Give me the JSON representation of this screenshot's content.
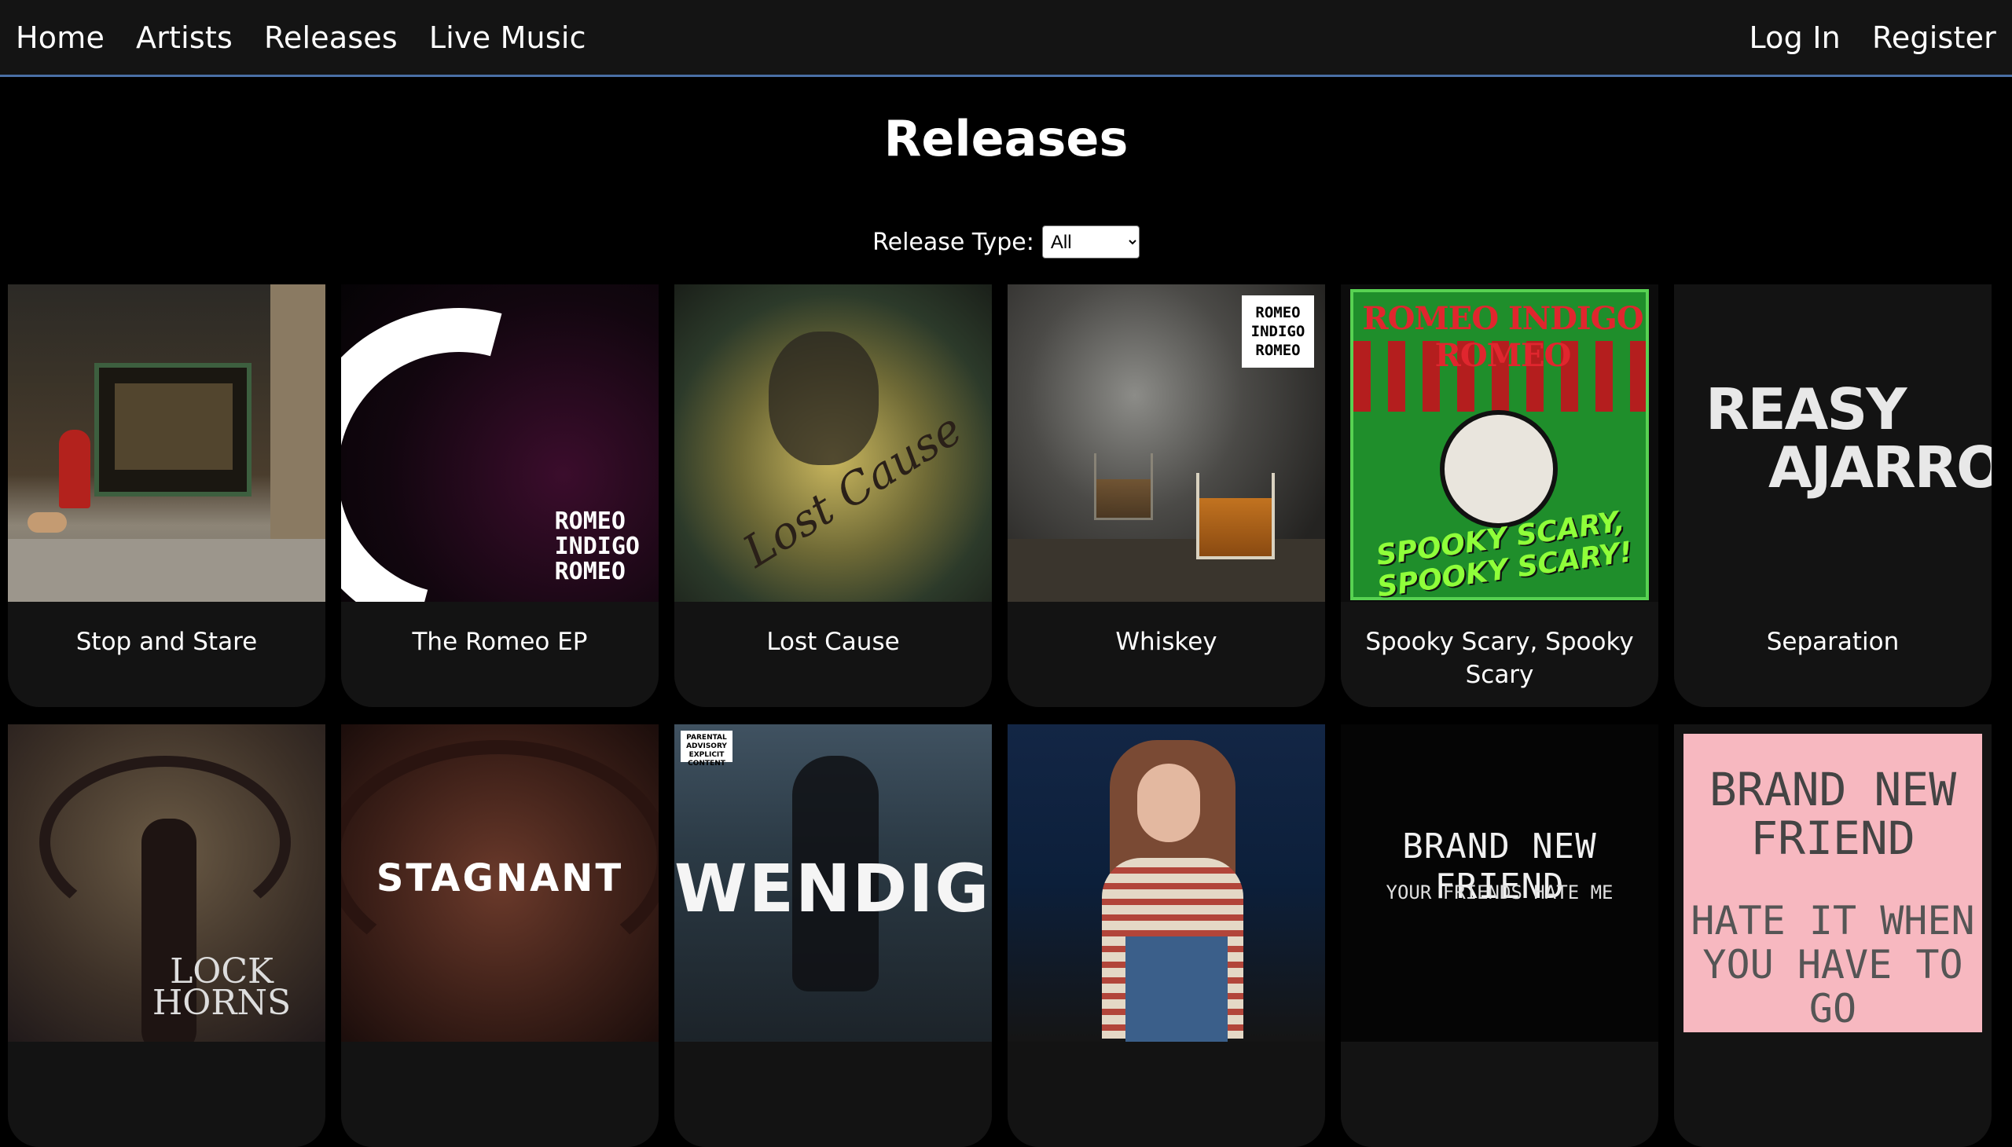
{
  "nav": {
    "left": [
      "Home",
      "Artists",
      "Releases",
      "Live Music"
    ],
    "right": [
      "Log In",
      "Register"
    ]
  },
  "page": {
    "title": "Releases",
    "filter_label": "Release Type:",
    "filter_value": "All"
  },
  "releases": [
    {
      "title": "Stop and Stare"
    },
    {
      "title": "The Romeo EP",
      "cover_text": "ROMEO\nINDIGO\nROMEO"
    },
    {
      "title": "Lost Cause",
      "cover_text": "Lost Cause"
    },
    {
      "title": "Whiskey",
      "cover_text": "ROMEO\nINDIGO\nROMEO"
    },
    {
      "title": "Spooky Scary, Spooky Scary",
      "cover_header": "ROMEO INDIGO ROMEO",
      "cover_text": "SPOOKY SCARY, SPOOKY SCARY!"
    },
    {
      "title": "Separation",
      "cover_line1": "REASY",
      "cover_line2": "AJARRO"
    },
    {
      "title": "",
      "cover_text": "LOCK HORNS"
    },
    {
      "title": "",
      "cover_text": "STAGNANT"
    },
    {
      "title": "",
      "cover_text": "WENDIGO",
      "advisory": "PARENTAL ADVISORY EXPLICIT CONTENT"
    },
    {
      "title": ""
    },
    {
      "title": "",
      "cover_line1": "BRAND NEW FRIEND",
      "cover_line2": "YOUR FRIENDS HATE ME"
    },
    {
      "title": "",
      "cover_line1": "BRAND NEW FRIEND",
      "cover_line2": "HATE IT WHEN YOU HAVE TO GO"
    }
  ]
}
